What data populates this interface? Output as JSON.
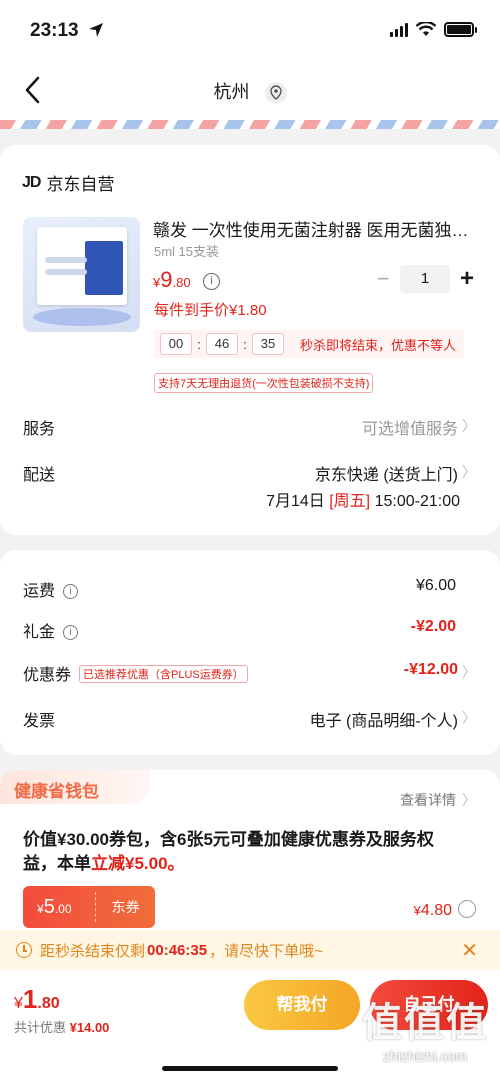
{
  "status": {
    "time": "23:13"
  },
  "nav": {
    "city": "杭州"
  },
  "shop": {
    "logo": "JD",
    "name": "京东自营"
  },
  "product": {
    "title": "赣发 一次性使用无菌注射器 医用无菌独…",
    "spec": "5ml 15支装",
    "price_symbol": "¥",
    "price_int": "9",
    "price_dec": ".80",
    "per_piece": "每件到手价¥1.80",
    "qty": "1",
    "timer": {
      "h": "00",
      "m": "46",
      "s": "35"
    },
    "timer_msg": "秒杀即将结束，优惠不等人",
    "return_tag": "支持7天无理由退货(一次性包装破损不支持)"
  },
  "service": {
    "label": "服务",
    "value": "可选增值服务"
  },
  "delivery": {
    "label": "配送",
    "method": "京东快递 (送货上门)",
    "date": "7月14日",
    "weekday": "[周五]",
    "time": "15:00-21:00"
  },
  "fees": {
    "shipping": {
      "label": "运费",
      "value": "¥6.00"
    },
    "gift": {
      "label": "礼金",
      "value": "-¥2.00"
    },
    "coupon": {
      "label": "优惠券",
      "tag": "已选推荐优惠（含PLUS运费券）",
      "value": "-¥12.00"
    },
    "invoice": {
      "label": "发票",
      "value": "电子 (商品明细-个人)"
    }
  },
  "health": {
    "title": "健康省钱包",
    "detail": "查看详情",
    "desc_before": "价值¥30.00券包，含6张5元可叠加健康优惠券及服务权益，本单",
    "desc_highlight": "立减¥5.00。",
    "coupon_symbol": "¥",
    "coupon_int": "5",
    "coupon_dec": ".00",
    "coupon_name": "东券",
    "price_symbol": "¥",
    "price": "4.80"
  },
  "notice": {
    "prefix": "距秒杀结束仅剩",
    "time": "00:46:35",
    "suffix": "，请尽快下单哦~"
  },
  "bottom": {
    "total_symbol": "¥",
    "total_int": "1",
    "total_dec": ".80",
    "saved_label": "共计优惠",
    "saved_value": "¥14.00",
    "help_pay": "帮我付",
    "self_pay": "自己付"
  },
  "watermark": {
    "glyphs": "值值值",
    "url": "zhizhizhi.com"
  }
}
